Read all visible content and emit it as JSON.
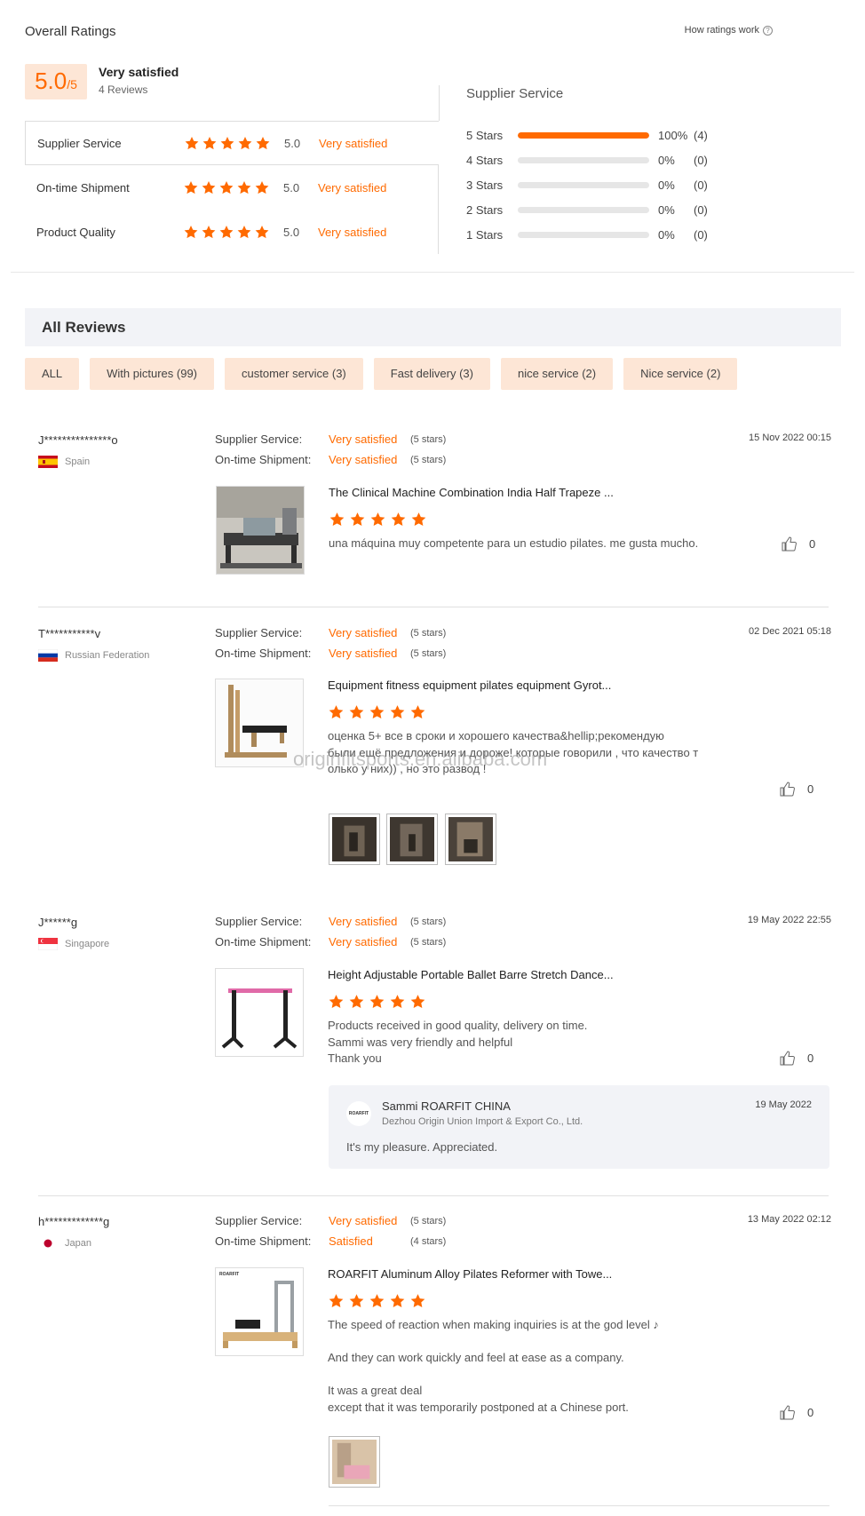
{
  "overall": {
    "title": "Overall Ratings",
    "how_link": "How ratings work",
    "score": "5.0",
    "score_max": "/5",
    "label": "Very satisfied",
    "count": "4 Reviews",
    "categories": [
      {
        "name": "Supplier Service",
        "value": "5.0",
        "label": "Very satisfied",
        "stars": 5
      },
      {
        "name": "On-time Shipment",
        "value": "5.0",
        "label": "Very satisfied",
        "stars": 5
      },
      {
        "name": "Product Quality",
        "value": "5.0",
        "label": "Very satisfied",
        "stars": 5
      }
    ]
  },
  "distribution": {
    "title": "Supplier Service",
    "rows": [
      {
        "label": "5 Stars",
        "fraction": 1.0,
        "pct": "100%",
        "count": "(4)"
      },
      {
        "label": "4 Stars",
        "fraction": 0,
        "pct": "0%",
        "count": "(0)"
      },
      {
        "label": "3 Stars",
        "fraction": 0,
        "pct": "0%",
        "count": "(0)"
      },
      {
        "label": "2 Stars",
        "fraction": 0,
        "pct": "0%",
        "count": "(0)"
      },
      {
        "label": "1 Stars",
        "fraction": 0,
        "pct": "0%",
        "count": "(0)"
      }
    ]
  },
  "reviews_header": "All Reviews",
  "tags": [
    "ALL",
    "With pictures (99)",
    "customer service (3)",
    "Fast delivery (3)",
    "nice service (2)",
    "Nice service (2)"
  ],
  "meta_keys": {
    "supplier": "Supplier Service:",
    "shipment": "On-time Shipment:"
  },
  "reviews": [
    {
      "user": "J***************o",
      "country": "Spain",
      "supplier_val": "Very satisfied",
      "supplier_stars": "(5 stars)",
      "shipment_val": "Very satisfied",
      "shipment_stars": "(5 stars)",
      "date": "15 Nov 2022 00:15",
      "product": "The Clinical Machine Combination India Half Trapeze ...",
      "stars": 5,
      "text": "una máquina muy competente para un estudio pilates.  me gusta mucho.",
      "likes": "0"
    },
    {
      "user": "T***********v",
      "country": "Russian Federation",
      "supplier_val": "Very satisfied",
      "supplier_stars": "(5 stars)",
      "shipment_val": "Very satisfied",
      "shipment_stars": "(5 stars)",
      "date": "02 Dec 2021 05:18",
      "product": "Equipment fitness equipment pilates equipment Gyrot...",
      "stars": 5,
      "text": "оценка 5+ все в сроки и хорошего качества&hellip;рекомендую\nбыли ещё предложения и дороже! которые говорили , что качество т\nолько у них)) , но это развод !",
      "likes": "0"
    },
    {
      "user": "J******g",
      "country": "Singapore",
      "supplier_val": "Very satisfied",
      "supplier_stars": "(5 stars)",
      "shipment_val": "Very satisfied",
      "shipment_stars": "(5 stars)",
      "date": "19 May 2022 22:55",
      "product": "Height Adjustable Portable Ballet Barre Stretch Dance...",
      "stars": 5,
      "text": "Products received in good quality, delivery on time.\nSammi was very friendly and helpful\nThank you",
      "likes": "0",
      "reply": {
        "logo": "ROARFIT",
        "name": "Sammi ROARFIT CHINA",
        "company": "Dezhou Origin Union Import & Export Co., Ltd.",
        "date": "19 May 2022",
        "text": "It's my pleasure. Appreciated."
      }
    },
    {
      "user": "h*************g",
      "country": "Japan",
      "supplier_val": "Very satisfied",
      "supplier_stars": "(5 stars)",
      "shipment_val": "Satisfied",
      "shipment_stars": "(4 stars)",
      "date": "13 May 2022 02:12",
      "product": "ROARFIT Aluminum Alloy Pilates Reformer with Towe...",
      "stars": 5,
      "text": "The speed of reaction when making inquiries is at the god level ♪\n\nAnd they can work quickly and feel at ease as a company.\n\nIt was a great deal\nexcept that it was temporarily postponed at a Chinese port.",
      "likes": "0"
    }
  ],
  "watermark": "originfitsports.en.alibaba.com",
  "colors": {
    "accent": "#ff6a00",
    "tag_bg": "#fde6d6",
    "header_bg": "#f2f3f7"
  }
}
